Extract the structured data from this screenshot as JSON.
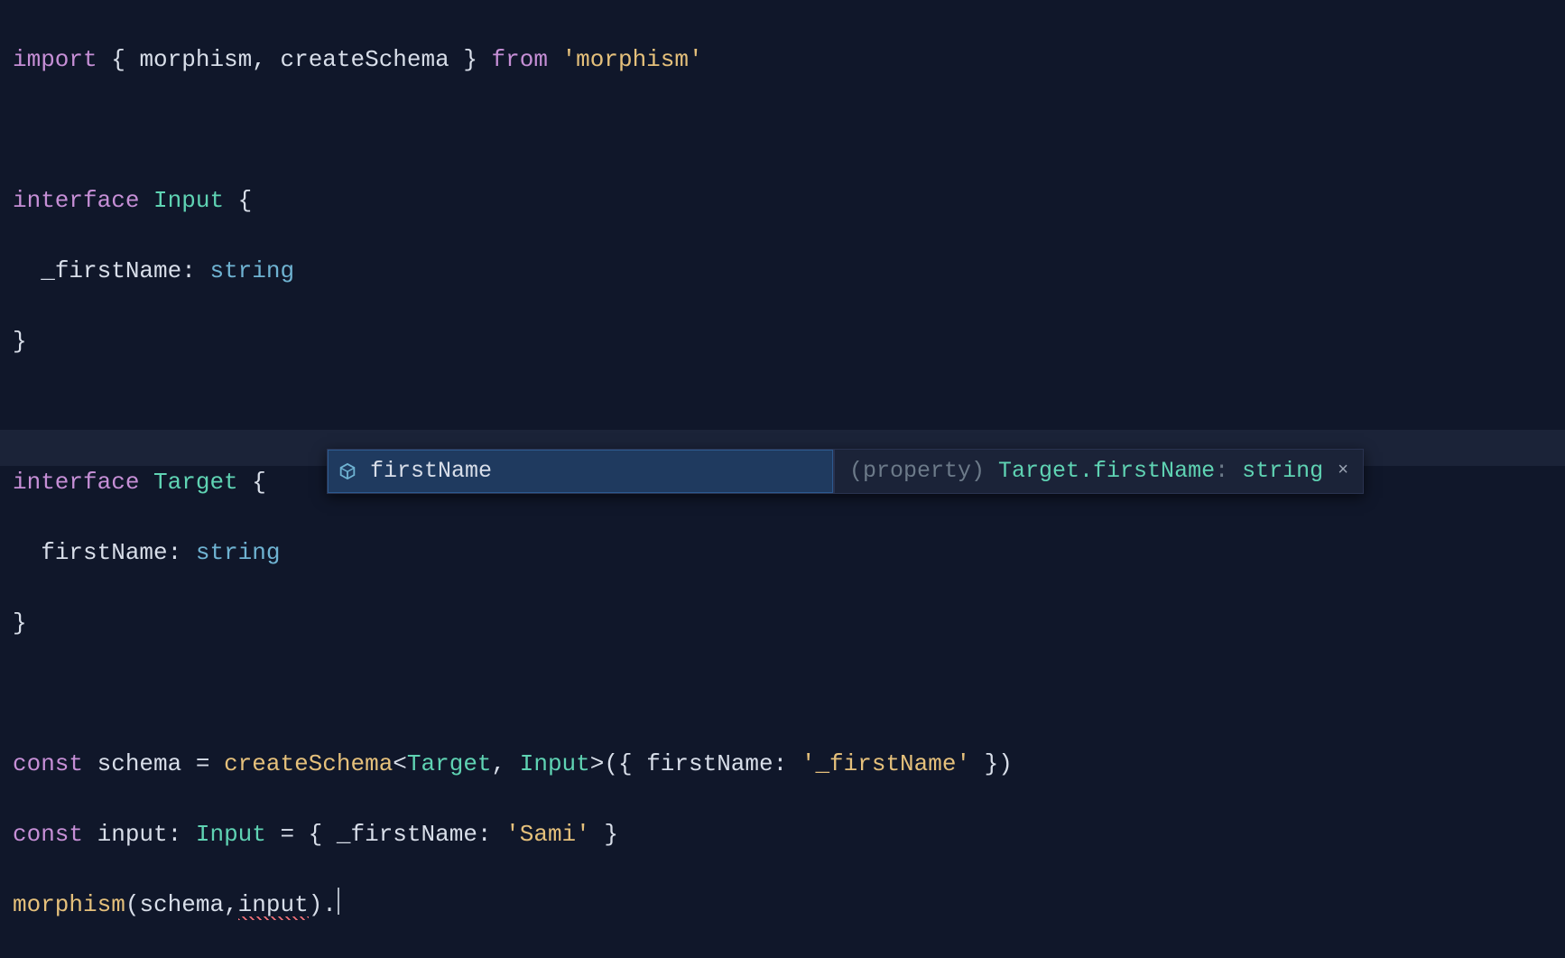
{
  "code": {
    "l1_import": "import",
    "l1_brace_open": " { ",
    "l1_m": "morphism",
    "l1_comma": ", ",
    "l1_cs": "createSchema",
    "l1_brace_close": " } ",
    "l1_from": "from",
    "l1_sp": " ",
    "l1_mod": "'morphism'",
    "l3_interface": "interface",
    "l3_sp": " ",
    "l3_name": "Input",
    "l3_brace": " {",
    "l4_indent": "  ",
    "l4_field": "_firstName",
    "l4_colon": ": ",
    "l4_type": "string",
    "l5_close": "}",
    "l7_interface": "interface",
    "l7_sp": " ",
    "l7_name": "Target",
    "l7_brace": " {",
    "l8_indent": "  ",
    "l8_field": "firstName",
    "l8_colon": ": ",
    "l8_type": "string",
    "l9_close": "}",
    "l11_const": "const",
    "l11_sp": " ",
    "l11_var": "schema",
    "l11_eq": " = ",
    "l11_fn": "createSchema",
    "l11_lt": "<",
    "l11_t1": "Target",
    "l11_comma": ", ",
    "l11_t2": "Input",
    "l11_gt": ">",
    "l11_paren": "({ ",
    "l11_key": "firstName",
    "l11_colon": ": ",
    "l11_val": "'_firstName'",
    "l11_end": " })",
    "l12_const": "const",
    "l12_sp": " ",
    "l12_var": "input",
    "l12_colon": ": ",
    "l12_type": "Input",
    "l12_eq": " = { ",
    "l12_key": "_firstName",
    "l12_kcolon": ": ",
    "l12_val": "'Sami'",
    "l12_end": " }",
    "l13_fn": "morphism",
    "l13_paren": "(",
    "l13_a1": "schema",
    "l13_comma": ",",
    "l13_a2": "input",
    "l13_close": ")",
    "l13_dot": "."
  },
  "autocomplete": {
    "item_label": "firstName",
    "detail_prefix": "(property) ",
    "detail_qual": "Target.firstName",
    "detail_colon": ": ",
    "detail_type": "string",
    "close_glyph": "×"
  }
}
